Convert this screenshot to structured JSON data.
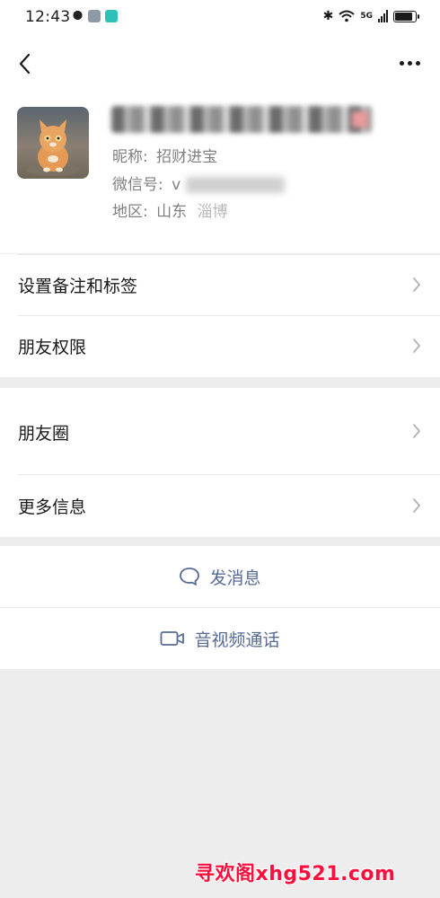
{
  "status_bar": {
    "time": "12:43",
    "network_label": "5G",
    "battery_level": 0.85,
    "icons": [
      "qq-icon",
      "message-icon",
      "green-app-icon",
      "bluetooth-icon",
      "wifi-icon",
      "signal-icon",
      "battery-icon"
    ]
  },
  "nav": {
    "back_icon": "chevron-left-icon",
    "more_icon": "more-dots-icon"
  },
  "profile": {
    "nickname_label": "昵称:",
    "nickname_value": "招财进宝",
    "wechat_id_label": "微信号:",
    "wechat_id_value_partial": "v",
    "region_label": "地区:",
    "region_value_province": "山东",
    "region_value_city_partial": "淄博"
  },
  "menu": {
    "remarks_tags": "设置备注和标签",
    "friend_permissions": "朋友权限",
    "moments": "朋友圈",
    "more_info": "更多信息"
  },
  "actions": {
    "send_message": "发消息",
    "video_call": "音视频通话"
  },
  "watermark": {
    "text": "寻欢阁xhg521.com"
  },
  "colors": {
    "accent_link": "#576b95",
    "page_background": "#ededed",
    "card_background": "#ffffff",
    "watermark": "#ff0f3c"
  }
}
